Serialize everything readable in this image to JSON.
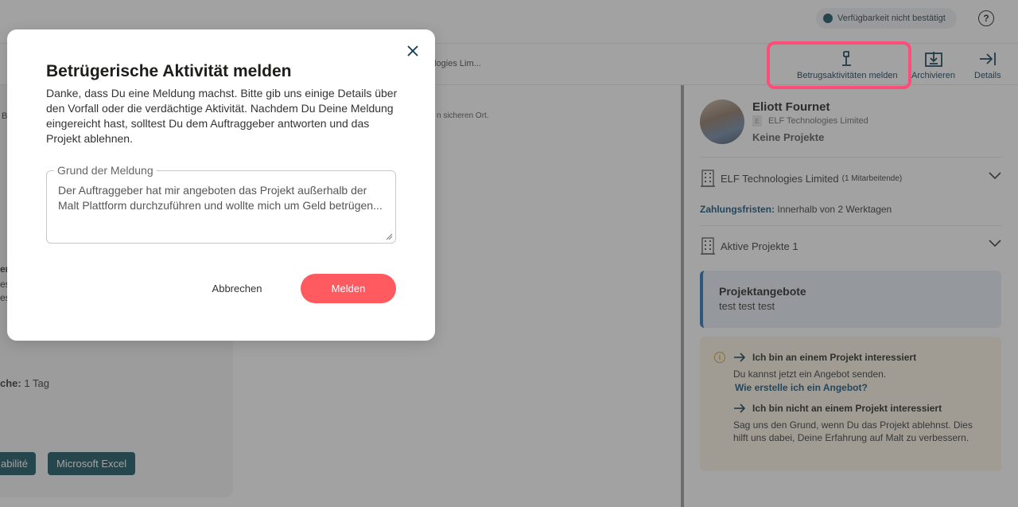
{
  "topbar": {
    "availability_label": "Verfügbarkeit nicht bestätigt",
    "help_glyph": "?"
  },
  "subbar": {
    "breadcrumb_fragment": "ologies Lim...",
    "tools": [
      {
        "label": "Betrugsaktivitäten melden",
        "icon": "report-flag-icon"
      },
      {
        "label": "Archivieren",
        "icon": "archive-icon"
      },
      {
        "label": "Details",
        "icon": "panel-collapse-icon"
      }
    ]
  },
  "main": {
    "right_fragment": "n sicheren Ort.",
    "left_fragments": {
      "a": "B",
      "b": "er",
      "c": "es",
      "d": "est",
      "duration_label": "che:",
      "duration_value": "1 Tag"
    },
    "tags": [
      "abilité",
      "Microsoft Excel"
    ]
  },
  "sidebar": {
    "profile": {
      "name": "Eliott Fournet",
      "company_initial": "E",
      "company": "ELF Technologies Limited",
      "projects": "Keine Projekte"
    },
    "company_accordion": {
      "label": "ELF Technologies Limited",
      "employees": "(1 Mitarbeitende)"
    },
    "payment": {
      "label": "Zahlungsfristen:",
      "value": "Innerhalb von 2 Werktagen"
    },
    "active_projects": {
      "label": "Aktive Projekte 1"
    },
    "offer": {
      "title": "Projektangebote",
      "subtitle": "test test test"
    },
    "info": {
      "icon_glyph": "i",
      "interested_title": "Ich bin an einem Projekt interessiert",
      "interested_text": "Du kannst jetzt ein Angebot senden.",
      "interested_link": "Wie erstelle ich ein Angebot?",
      "not_interested_title": "Ich bin nicht an einem Projekt interessiert",
      "not_interested_text": "Sag uns den Grund, wenn Du das Projekt ablehnst. Dies hilft uns dabei, Deine Erfahrung auf Malt zu verbessern."
    }
  },
  "modal": {
    "title": "Betrügerische Aktivität melden",
    "description": "Danke, dass Du eine Meldung machst. Bitte gib uns einige Details über den Vorfall oder die verdächtige Aktivität. Nachdem Du Deine Meldung eingereicht hast, solltest Du dem Auftraggeber antworten und das Projekt ablehnen.",
    "field_label": "Grund der Meldung",
    "field_value": "Der Auftraggeber hat mir angeboten das Projekt außerhalb der Malt Plattform durchzuführen und wollte mich um Geld betrügen...",
    "cancel_label": "Abbrechen",
    "submit_label": "Melden"
  },
  "colors": {
    "accent_primary": "#ff5a5f",
    "highlight": "#ff4d7a",
    "dark_teal": "#0f4f5b",
    "link_blue": "#0c4f7a"
  }
}
